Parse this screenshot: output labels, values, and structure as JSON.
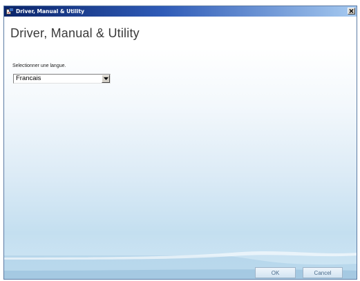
{
  "window": {
    "title": "Driver, Manual & Utility",
    "close_symbol": "×"
  },
  "header": {
    "title": "Driver, Manual & Utility"
  },
  "language": {
    "label": "Selectionner une langue.",
    "selected": "Francais"
  },
  "buttons": {
    "ok_label": "OK",
    "cancel_label": "Cancel"
  },
  "icons": {
    "app": "app-icon",
    "close": "close-icon",
    "dropdown": "chevron-down-icon"
  },
  "colors": {
    "titlebar_start": "#0a246a",
    "titlebar_end": "#a6caf0",
    "content_bg": "#dcebf6",
    "button_text": "#4a6a8a"
  }
}
